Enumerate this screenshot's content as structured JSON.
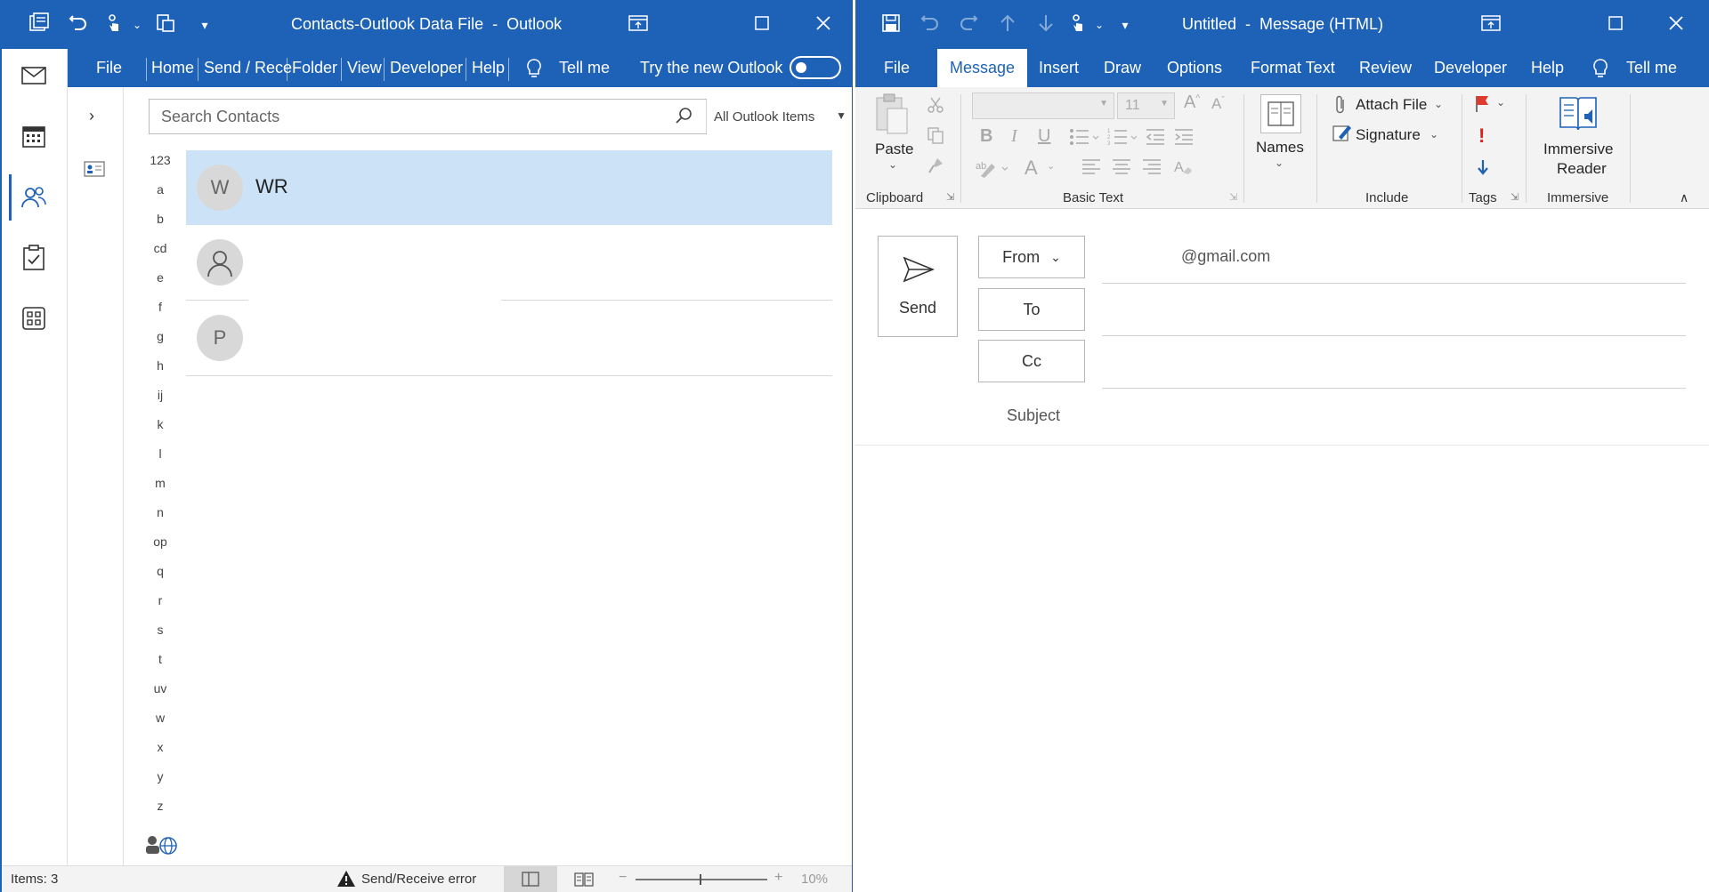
{
  "left": {
    "title": "Contacts-Outlook Data File  -  Outlook",
    "menu": [
      "File",
      "Home",
      "Send / Rece",
      "Folder",
      "View",
      "Developer",
      "Help"
    ],
    "tell_me": "Tell me",
    "try_new_outlook": "Try the new Outlook",
    "search": {
      "placeholder": "Search Contacts",
      "scope": "All Outlook Items"
    },
    "alphabet": [
      "123",
      "a",
      "b",
      "cd",
      "e",
      "f",
      "g",
      "h",
      "ij",
      "k",
      "l",
      "m",
      "n",
      "op",
      "q",
      "r",
      "s",
      "t",
      "uv",
      "w",
      "x",
      "y",
      "z"
    ],
    "contacts": [
      {
        "initials": "W",
        "name": "WR",
        "selected": true
      },
      {
        "initials": "",
        "name": "",
        "selected": false
      },
      {
        "initials": "P",
        "name": "",
        "selected": false
      }
    ],
    "status": {
      "items": "Items: 3",
      "error": "Send/Receive error",
      "zoom": "10%"
    }
  },
  "right": {
    "title": "Untitled  -  Message (HTML)",
    "menu": [
      "File",
      "Message",
      "Insert",
      "Draw",
      "Options",
      "Format Text",
      "Review",
      "Developer",
      "Help"
    ],
    "active_tab": "Message",
    "tell_me": "Tell me",
    "ribbon": {
      "paste": "Paste",
      "font_size": "11",
      "names": "Names",
      "attach_file": "Attach File",
      "signature": "Signature",
      "immersive_reader_1": "Immersive",
      "immersive_reader_2": "Reader",
      "groups": [
        "Clipboard",
        "Basic Text",
        "Include",
        "Tags",
        "Immersive"
      ]
    },
    "compose": {
      "send": "Send",
      "from": "From",
      "from_value": "@gmail.com",
      "to": "To",
      "cc": "Cc",
      "subject": "Subject"
    }
  },
  "colors": {
    "accent": "#1e62b8",
    "selected_row": "#cce2f7"
  }
}
